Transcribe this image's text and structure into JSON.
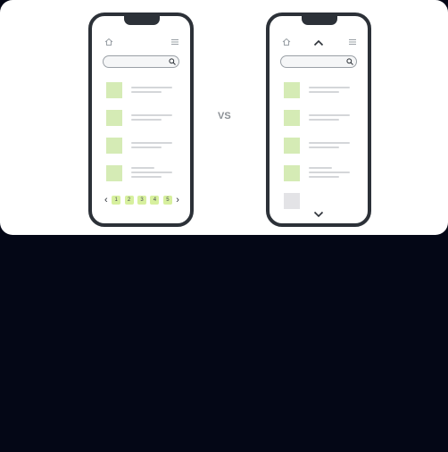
{
  "comparison": {
    "vs_label": "VS"
  },
  "left_phone": {
    "top_icons": [
      "home-icon",
      "menu-icon"
    ],
    "search_icon": "search-icon",
    "list_items": 4,
    "pagination": {
      "prev_icon": "chevron-left-icon",
      "pages": [
        "1",
        "2",
        "3",
        "4",
        "5"
      ],
      "next_icon": "chevron-right-icon"
    }
  },
  "right_phone": {
    "top_icons": [
      "home-icon",
      "menu-icon"
    ],
    "scroll_up_icon": "chevron-up-icon",
    "search_icon": "search-icon",
    "list_items": 5,
    "scroll_down_icon": "chevron-down-icon"
  },
  "colors": {
    "background": "#040716",
    "card": "#ffffff",
    "phone_frame": "#2c3138",
    "thumbnail": "#d5ebb5",
    "page_number": "#d7f09e",
    "placeholder_line": "#d4d6d9"
  }
}
